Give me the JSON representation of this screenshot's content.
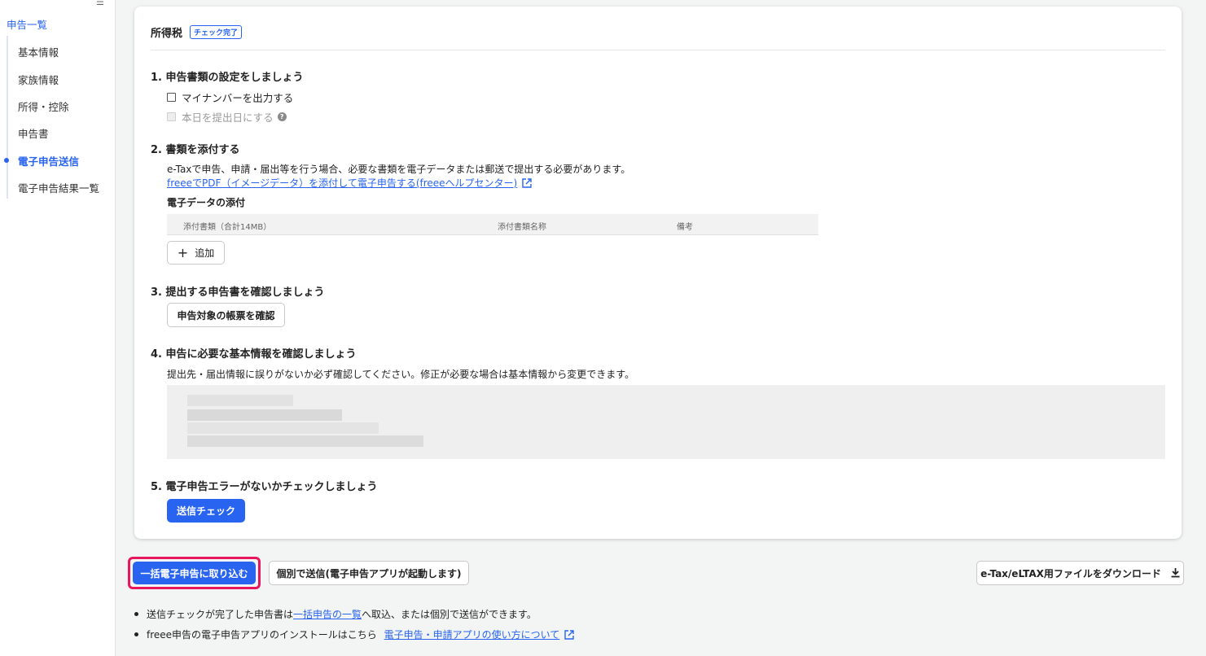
{
  "sidebar": {
    "top_link": "申告一覧",
    "items": [
      {
        "label": "基本情報"
      },
      {
        "label": "家族情報"
      },
      {
        "label": "所得・控除"
      },
      {
        "label": "申告書"
      },
      {
        "label": "電子申告送信",
        "active": true
      },
      {
        "label": "電子申告結果一覧"
      }
    ]
  },
  "card": {
    "title": "所得税",
    "status_badge": "チェック完了",
    "step1": {
      "heading": "1. 申告書類の設定をしましょう",
      "checkbox_mynumber": "マイナンバーを出力する",
      "checkbox_today": "本日を提出日にする"
    },
    "step2": {
      "heading": "2. 書類を添付する",
      "description": "e-Taxで申告、申請・届出等を行う場合、必要な書類を電子データまたは郵送で提出する必要があります。",
      "help_link": "freeeでPDF（イメージデータ）を添付して電子申告する(freeeヘルプセンター)",
      "subheading": "電子データの添付",
      "table_headers": [
        "添付書類（合計14MB）",
        "添付書類名称",
        "備考"
      ],
      "add_button": "追加"
    },
    "step3": {
      "heading": "3. 提出する申告書を確認しましょう",
      "button": "申告対象の帳票を確認"
    },
    "step4": {
      "heading": "4. 申告に必要な基本情報を確認しましょう",
      "description": "提出先・届出情報に誤りがないか必ず確認してください。修正が必要な場合は基本情報から変更できます。"
    },
    "step5": {
      "heading": "5. 電子申告エラーがないかチェックしましょう",
      "button": "送信チェック"
    }
  },
  "actions": {
    "bulk_import": "一括電子申告に取り込む",
    "individual_send": "個別で送信(電子申告アプリが起動します)",
    "download": "e-Tax/eLTAX用ファイルをダウンロード"
  },
  "notes": {
    "line1_pre": "送信チェックが完了した申告書は",
    "line1_link": "一括申告の一覧",
    "line1_post": "へ取込、または個別で送信ができます。",
    "line2_pre": "freee申告の電子申告アプリのインストールはこちら",
    "line2_link": "電子申告・申請アプリの使い方について"
  },
  "colors": {
    "accent": "#2864f0",
    "highlight": "#e8175d"
  }
}
